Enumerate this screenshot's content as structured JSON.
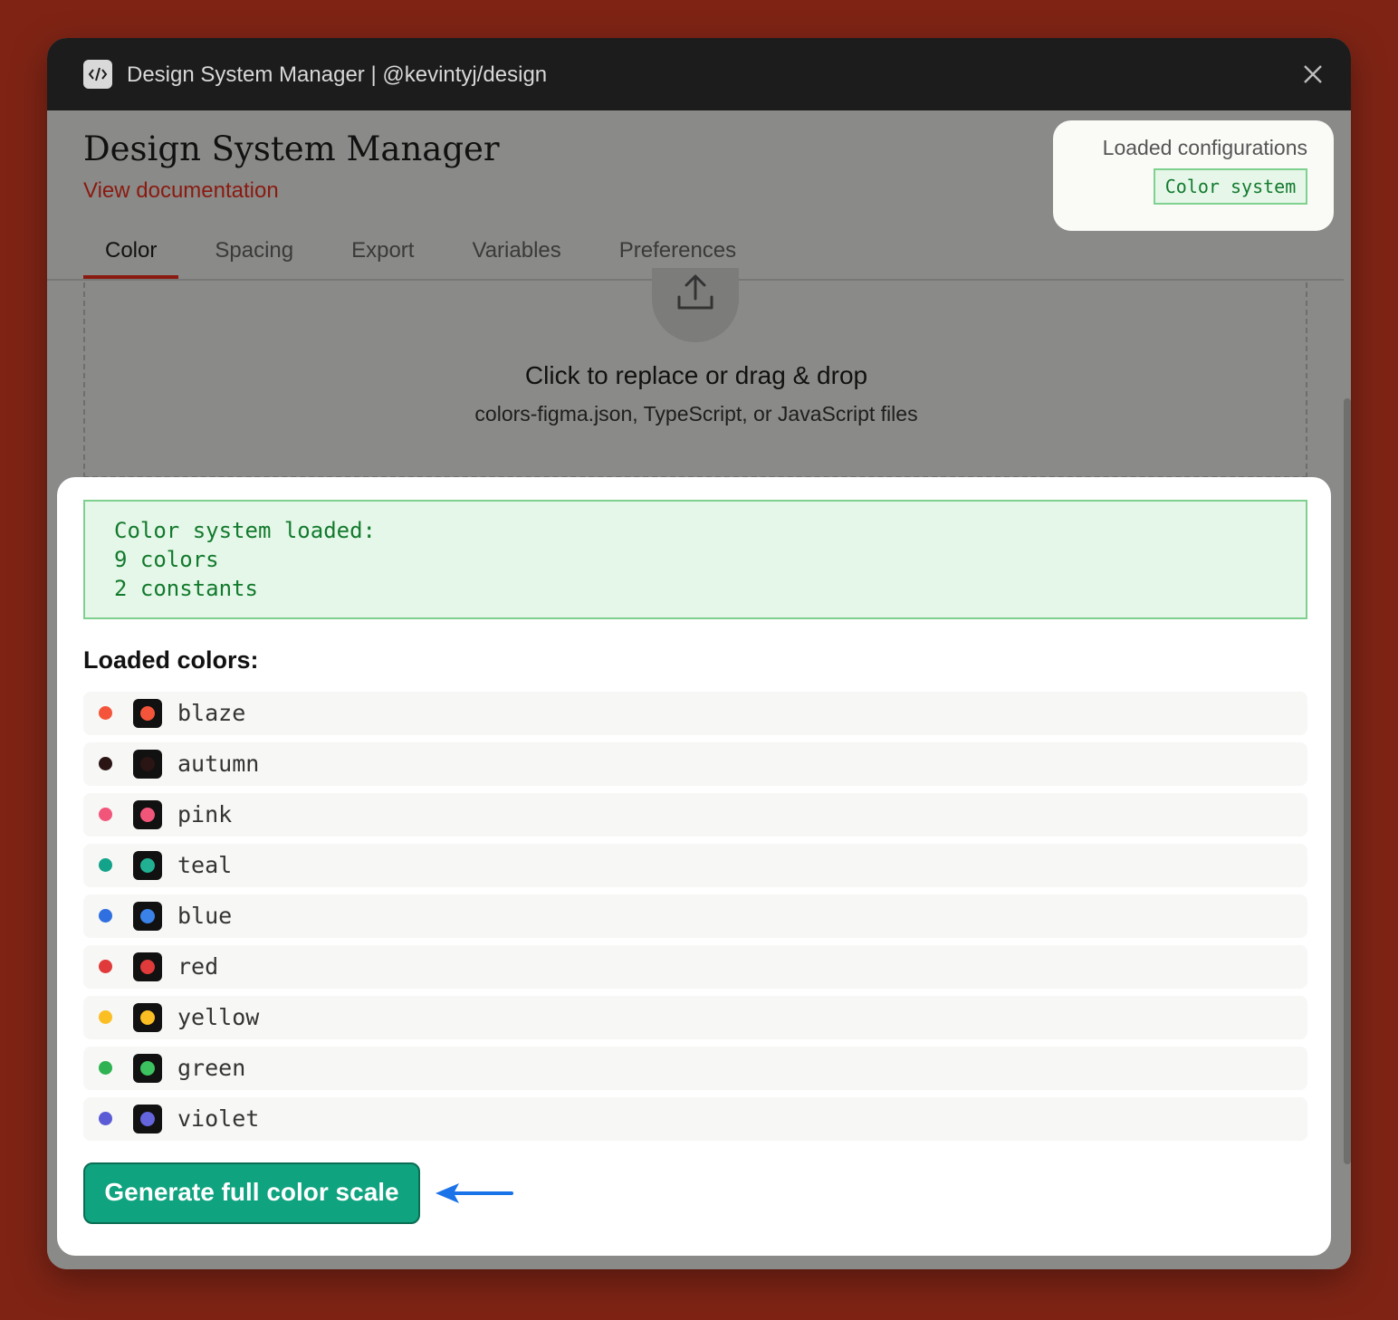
{
  "window": {
    "title": "Design System Manager | @kevintyj/design",
    "app_icon": "code-icon",
    "close_icon": "close-icon"
  },
  "header": {
    "title": "Design System Manager",
    "doc_link": "View documentation"
  },
  "tabs": [
    {
      "label": "Color",
      "active": true
    },
    {
      "label": "Spacing",
      "active": false
    },
    {
      "label": "Export",
      "active": false
    },
    {
      "label": "Variables",
      "active": false
    },
    {
      "label": "Preferences",
      "active": false
    }
  ],
  "dropzone": {
    "icon": "upload-icon",
    "title": "Click to replace or drag & drop",
    "subtitle": "colors-figma.json, TypeScript, or JavaScript files"
  },
  "configs": {
    "title": "Loaded configurations",
    "badge": "Color system"
  },
  "status": {
    "line1": "Color system loaded:",
    "line2": "9 colors",
    "line3": "2 constants"
  },
  "colors_section": {
    "title": "Loaded colors:",
    "items": [
      {
        "name": "blaze",
        "light": "#f4553a",
        "dark": "#f4553a"
      },
      {
        "name": "autumn",
        "light": "#2a1414",
        "dark": "#2a1414"
      },
      {
        "name": "pink",
        "light": "#f2557a",
        "dark": "#f2557a"
      },
      {
        "name": "teal",
        "light": "#12a38a",
        "dark": "#22b093"
      },
      {
        "name": "blue",
        "light": "#2f6fe0",
        "dark": "#3b82e8"
      },
      {
        "name": "red",
        "light": "#e03a3a",
        "dark": "#e03a3a"
      },
      {
        "name": "yellow",
        "light": "#fbbf24",
        "dark": "#fbbf24"
      },
      {
        "name": "green",
        "light": "#2fb251",
        "dark": "#3cc25e"
      },
      {
        "name": "violet",
        "light": "#5b5bd6",
        "dark": "#6464dc"
      }
    ]
  },
  "action": {
    "label": "Generate full color scale",
    "pointer": "arrow-left-icon",
    "pointer_color": "#1a73e8"
  }
}
